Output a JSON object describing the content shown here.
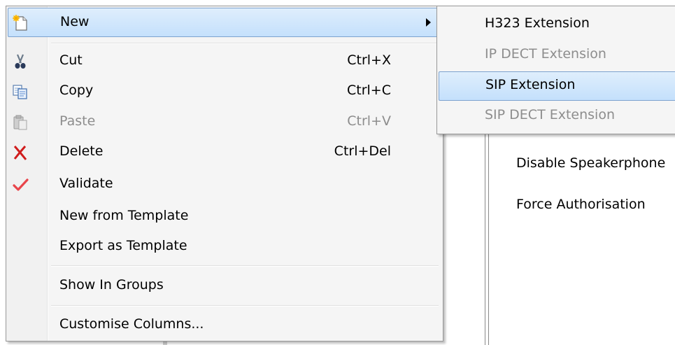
{
  "context_menu": {
    "items": [
      {
        "label": "New",
        "shortcut": "",
        "icon": "new-document-icon",
        "highlighted": true,
        "disabled": false,
        "has_submenu": true
      },
      {
        "label": "Cut",
        "shortcut": "Ctrl+X",
        "icon": "scissors-icon",
        "disabled": false
      },
      {
        "label": "Copy",
        "shortcut": "Ctrl+C",
        "icon": "copy-icon",
        "disabled": false
      },
      {
        "label": "Paste",
        "shortcut": "Ctrl+V",
        "icon": "paste-icon",
        "disabled": true
      },
      {
        "label": "Delete",
        "shortcut": "Ctrl+Del",
        "icon": "delete-x-icon",
        "disabled": false
      },
      {
        "label": "Validate",
        "shortcut": "",
        "icon": "checkmark-icon",
        "disabled": false
      },
      {
        "label": "New from Template",
        "shortcut": "",
        "disabled": false
      },
      {
        "label": "Export as Template",
        "shortcut": "",
        "disabled": false
      },
      {
        "label": "Show In Groups",
        "shortcut": "",
        "disabled": false
      },
      {
        "label": "Customise Columns...",
        "shortcut": "",
        "disabled": false
      }
    ]
  },
  "submenu": {
    "items": [
      {
        "label": "H323 Extension",
        "disabled": false,
        "highlighted": false
      },
      {
        "label": "IP DECT Extension",
        "disabled": true,
        "highlighted": false
      },
      {
        "label": "SIP Extension",
        "disabled": false,
        "highlighted": true
      },
      {
        "label": "SIP DECT Extension",
        "disabled": true,
        "highlighted": false
      }
    ]
  },
  "background": {
    "items": [
      "Disable Speakerphone",
      "Force Authorisation"
    ]
  },
  "colors": {
    "highlight_top": "#dfeefc",
    "highlight_bottom": "#c4e0fc",
    "highlight_border": "#7da2ce",
    "disabled_text": "#8d8d8d",
    "delete_red": "#d01c1c",
    "validate_red": "#e8454b"
  }
}
